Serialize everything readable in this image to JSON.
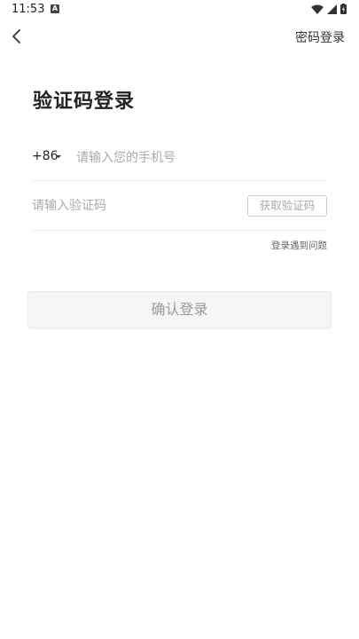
{
  "status_bar": {
    "time": "11:53",
    "notification_icon": "a-icon",
    "right_icons": [
      "wifi-icon",
      "signal-icon",
      "battery-charging-icon"
    ]
  },
  "nav": {
    "back_icon": "back-arrow-icon",
    "password_login_label": "密码登录"
  },
  "page": {
    "title": "验证码登录"
  },
  "phone": {
    "country_code": "+86",
    "placeholder": "请输入您的手机号",
    "value": ""
  },
  "code": {
    "placeholder": "请输入验证码",
    "value": "",
    "get_code_label": "获取验证码"
  },
  "help_link": "登录遇到问题",
  "confirm_button_label": "确认登录"
}
